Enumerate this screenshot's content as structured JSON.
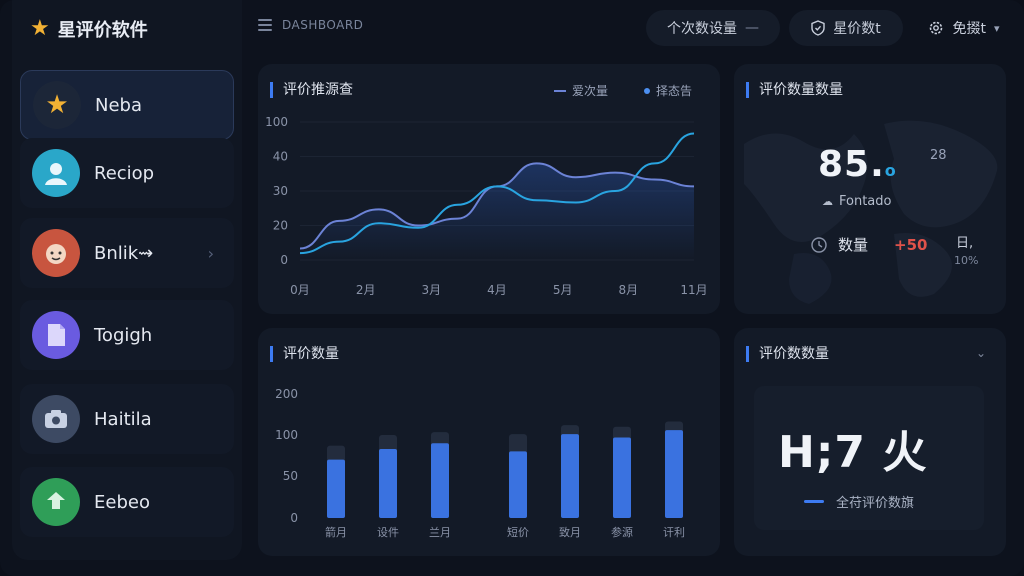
{
  "app": {
    "title": "星评价软件"
  },
  "sidebar": {
    "items": [
      {
        "label": "Neba",
        "icon": "star-icon",
        "color": "#f2b134",
        "active": true
      },
      {
        "label": "Reciop",
        "icon": "user-avatar-icon",
        "color": "#2aa7c9"
      },
      {
        "label": "Bnlik⇝",
        "icon": "face-avatar-icon",
        "color": "#c8553f"
      },
      {
        "label": "Togigh",
        "icon": "document-icon",
        "color": "#6a5be0"
      },
      {
        "label": "Haitila",
        "icon": "camera-icon",
        "color": "#3d4a63"
      },
      {
        "label": "Eebeo",
        "icon": "leaf-icon",
        "color": "#2f9e58"
      }
    ]
  },
  "header": {
    "breadcrumb": "DASHBOARD",
    "pill1": "个次数设量",
    "pill2": "星价数t",
    "pill3": "免掇t"
  },
  "line_card": {
    "title": "评价推源查",
    "legend1": "爱次量",
    "legend2": "择态告"
  },
  "map_card": {
    "title": "评价数量数量",
    "value": "85.",
    "value_suffix": "o",
    "corner": "28",
    "place": "Fontado",
    "label": "数量",
    "delta": "+50",
    "side_top": "日,",
    "side_pct": "10%"
  },
  "bar_card": {
    "title": "评价数量"
  },
  "total_card": {
    "title": "评价数数量",
    "value": "H;7 火",
    "caption": "全苻评价数旗"
  },
  "colors": {
    "accent": "#3d7bf2",
    "line_a": "#6c83d6",
    "line_b": "#29a4e0",
    "delta": "#e0524a"
  },
  "chart_data": [
    {
      "type": "line",
      "title": "评价推源查",
      "categories": [
        "0月",
        "2月",
        "3月",
        "4月",
        "5月",
        "8月",
        "11月"
      ],
      "yticks": [
        "100",
        "40",
        "30",
        "20",
        "0"
      ],
      "series": [
        {
          "name": "爱次量",
          "values": [
            5,
            17,
            22,
            15,
            18,
            32,
            42,
            36,
            38,
            35,
            32
          ]
        },
        {
          "name": "择态告",
          "values": [
            3,
            8,
            16,
            14,
            24,
            32,
            26,
            25,
            30,
            42,
            55
          ]
        }
      ]
    },
    {
      "type": "bar",
      "title": "评价数量",
      "categories": [
        "箭月",
        "设件",
        "兰月",
        "短价",
        "致月",
        "参源",
        "讦利"
      ],
      "values": [
        70,
        83,
        90,
        80,
        102,
        97,
        112
      ],
      "totals": [
        87,
        100,
        107,
        102,
        124,
        120,
        133
      ],
      "yticks": [
        "200",
        "100",
        "50",
        "0"
      ]
    }
  ]
}
